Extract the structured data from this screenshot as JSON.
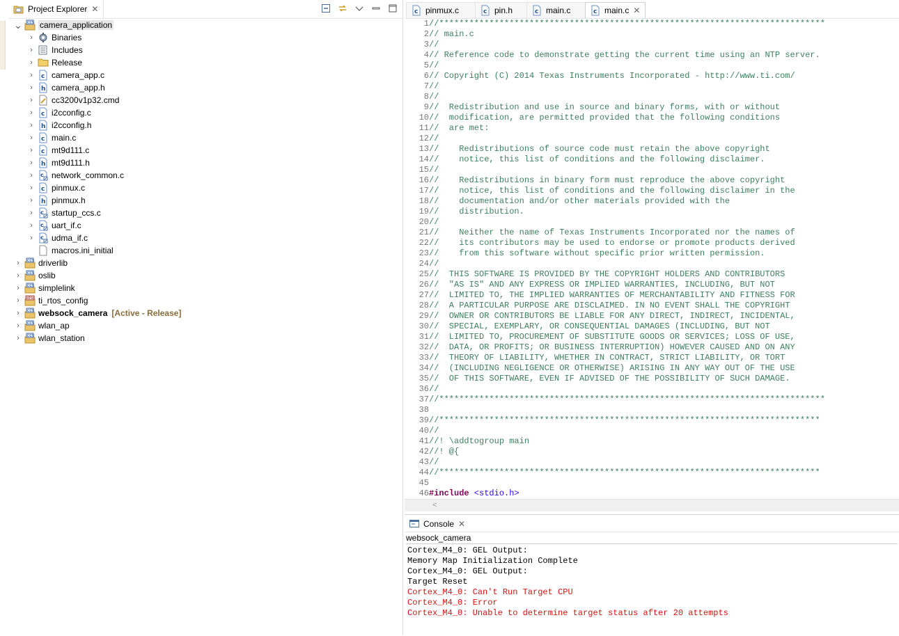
{
  "explorer": {
    "title": "Project Explorer",
    "items": [
      {
        "label": "camera_application",
        "depth": 0,
        "expanded": true,
        "icon": "ccs-project-icon",
        "selected": true
      },
      {
        "label": "Binaries",
        "depth": 1,
        "icon": "binaries-icon"
      },
      {
        "label": "Includes",
        "depth": 1,
        "icon": "includes-icon"
      },
      {
        "label": "Release",
        "depth": 1,
        "icon": "folder-icon"
      },
      {
        "label": "camera_app.c",
        "depth": 1,
        "icon": "c-file-icon"
      },
      {
        "label": "camera_app.h",
        "depth": 1,
        "icon": "h-file-icon"
      },
      {
        "label": "cc3200v1p32.cmd",
        "depth": 1,
        "icon": "cmd-file-icon"
      },
      {
        "label": "i2cconfig.c",
        "depth": 1,
        "icon": "c-file-icon"
      },
      {
        "label": "i2cconfig.h",
        "depth": 1,
        "icon": "h-file-icon"
      },
      {
        "label": "main.c",
        "depth": 1,
        "icon": "c-file-icon"
      },
      {
        "label": "mt9d111.c",
        "depth": 1,
        "icon": "c-file-icon"
      },
      {
        "label": "mt9d111.h",
        "depth": 1,
        "icon": "h-file-icon"
      },
      {
        "label": "network_common.c",
        "depth": 1,
        "icon": "linked-c-file-icon"
      },
      {
        "label": "pinmux.c",
        "depth": 1,
        "icon": "c-file-icon"
      },
      {
        "label": "pinmux.h",
        "depth": 1,
        "icon": "h-file-icon"
      },
      {
        "label": "startup_ccs.c",
        "depth": 1,
        "icon": "linked-c-file-icon"
      },
      {
        "label": "uart_if.c",
        "depth": 1,
        "icon": "linked-c-file-icon"
      },
      {
        "label": "udma_if.c",
        "depth": 1,
        "icon": "linked-c-file-icon"
      },
      {
        "label": "macros.ini_initial",
        "depth": 1,
        "icon": "file-icon",
        "no_chevron": true
      },
      {
        "label": "driverlib",
        "depth": 0,
        "icon": "ccs-project-icon"
      },
      {
        "label": "oslib",
        "depth": 0,
        "icon": "ccs-project-icon"
      },
      {
        "label": "simplelink",
        "depth": 0,
        "icon": "ccs-project-icon"
      },
      {
        "label": "ti_rtos_config",
        "depth": 0,
        "icon": "rtsc-project-icon"
      },
      {
        "label": "websock_camera",
        "depth": 0,
        "icon": "ccs-project-icon",
        "active": true,
        "badge": "[Active - Release]"
      },
      {
        "label": "wlan_ap",
        "depth": 0,
        "icon": "ccs-project-icon"
      },
      {
        "label": "wlan_station",
        "depth": 0,
        "icon": "ccs-project-icon"
      }
    ]
  },
  "editor": {
    "tabs": [
      {
        "label": "pinmux.c",
        "icon": "c-file-icon"
      },
      {
        "label": "pin.h",
        "icon": "c-file-icon"
      },
      {
        "label": "main.c",
        "icon": "c-file-icon"
      },
      {
        "label": "main.c",
        "icon": "c-file-icon",
        "active": true
      }
    ],
    "lines": [
      {
        "n": "1",
        "t": "//*****************************************************************************",
        "k": "ct"
      },
      {
        "n": "2",
        "t": "// main.c",
        "k": "ct"
      },
      {
        "n": "3",
        "t": "//",
        "k": "ct"
      },
      {
        "n": "4",
        "t": "// Reference code to demonstrate getting the current time using an NTP server.",
        "k": "ct"
      },
      {
        "n": "5",
        "t": "//",
        "k": "ct"
      },
      {
        "n": "6",
        "t": "// Copyright (C) 2014 Texas Instruments Incorporated - http://www.ti.com/",
        "k": "ct"
      },
      {
        "n": "7",
        "t": "//",
        "k": "ct"
      },
      {
        "n": "8",
        "t": "//",
        "k": "ct"
      },
      {
        "n": "9",
        "t": "//  Redistribution and use in source and binary forms, with or without",
        "k": "ct"
      },
      {
        "n": "10",
        "t": "//  modification, are permitted provided that the following conditions",
        "k": "ct"
      },
      {
        "n": "11",
        "t": "//  are met:",
        "k": "ct"
      },
      {
        "n": "12",
        "t": "//",
        "k": "ct"
      },
      {
        "n": "13",
        "t": "//    Redistributions of source code must retain the above copyright",
        "k": "ct"
      },
      {
        "n": "14",
        "t": "//    notice, this list of conditions and the following disclaimer.",
        "k": "ct"
      },
      {
        "n": "15",
        "t": "//",
        "k": "ct"
      },
      {
        "n": "16",
        "t": "//    Redistributions in binary form must reproduce the above copyright",
        "k": "ct"
      },
      {
        "n": "17",
        "t": "//    notice, this list of conditions and the following disclaimer in the",
        "k": "ct"
      },
      {
        "n": "18",
        "t": "//    documentation and/or other materials provided with the",
        "k": "ct"
      },
      {
        "n": "19",
        "t": "//    distribution.",
        "k": "ct"
      },
      {
        "n": "20",
        "t": "//",
        "k": "ct"
      },
      {
        "n": "21",
        "t": "//    Neither the name of Texas Instruments Incorporated nor the names of",
        "k": "ct"
      },
      {
        "n": "22",
        "t": "//    its contributors may be used to endorse or promote products derived",
        "k": "ct"
      },
      {
        "n": "23",
        "t": "//    from this software without specific prior written permission.",
        "k": "ct"
      },
      {
        "n": "24",
        "t": "//",
        "k": "ct"
      },
      {
        "n": "25",
        "t": "//  THIS SOFTWARE IS PROVIDED BY THE COPYRIGHT HOLDERS AND CONTRIBUTORS",
        "k": "ct"
      },
      {
        "n": "26",
        "t": "//  \"AS IS\" AND ANY EXPRESS OR IMPLIED WARRANTIES, INCLUDING, BUT NOT",
        "k": "ct"
      },
      {
        "n": "27",
        "t": "//  LIMITED TO, THE IMPLIED WARRANTIES OF MERCHANTABILITY AND FITNESS FOR",
        "k": "ct"
      },
      {
        "n": "28",
        "t": "//  A PARTICULAR PURPOSE ARE DISCLAIMED. IN NO EVENT SHALL THE COPYRIGHT",
        "k": "ct"
      },
      {
        "n": "29",
        "t": "//  OWNER OR CONTRIBUTORS BE LIABLE FOR ANY DIRECT, INDIRECT, INCIDENTAL,",
        "k": "ct"
      },
      {
        "n": "30",
        "t": "//  SPECIAL, EXEMPLARY, OR CONSEQUENTIAL DAMAGES (INCLUDING, BUT NOT",
        "k": "ct"
      },
      {
        "n": "31",
        "t": "//  LIMITED TO, PROCUREMENT OF SUBSTITUTE GOODS OR SERVICES; LOSS OF USE,",
        "k": "ct"
      },
      {
        "n": "32",
        "t": "//  DATA, OR PROFITS; OR BUSINESS INTERRUPTION) HOWEVER CAUSED AND ON ANY",
        "k": "ct"
      },
      {
        "n": "33",
        "t": "//  THEORY OF LIABILITY, WHETHER IN CONTRACT, STRICT LIABILITY, OR TORT",
        "k": "ct"
      },
      {
        "n": "34",
        "t": "//  (INCLUDING NEGLIGENCE OR OTHERWISE) ARISING IN ANY WAY OUT OF THE USE",
        "k": "ct"
      },
      {
        "n": "35",
        "t": "//  OF THIS SOFTWARE, EVEN IF ADVISED OF THE POSSIBILITY OF SUCH DAMAGE.",
        "k": "ct"
      },
      {
        "n": "36",
        "t": "//",
        "k": "ct"
      },
      {
        "n": "37",
        "t": "//*****************************************************************************",
        "k": "ct"
      },
      {
        "n": "38",
        "t": "",
        "k": "ct"
      },
      {
        "n": "39",
        "t": "//****************************************************************************",
        "k": "ct"
      },
      {
        "n": "40",
        "t": "//",
        "k": "ct"
      },
      {
        "n": "41",
        "t": "//! \\addtogroup main",
        "k": "ct"
      },
      {
        "n": "42",
        "t": "//! @{",
        "k": "ct"
      },
      {
        "n": "43",
        "t": "//",
        "k": "ct"
      },
      {
        "n": "44",
        "t": "//****************************************************************************",
        "k": "ct"
      },
      {
        "n": "45",
        "t": "",
        "k": "ct"
      },
      {
        "n": "46",
        "t": "#include",
        "k": "kw",
        "t2": " <stdio.h>"
      }
    ]
  },
  "console": {
    "title": "Console",
    "name": "websock_camera",
    "lines": [
      {
        "t": "Cortex_M4_0: GEL Output:",
        "err": false
      },
      {
        "t": "Memory Map Initialization Complete",
        "err": false
      },
      {
        "t": "Cortex_M4_0: GEL Output:",
        "err": false
      },
      {
        "t": "Target Reset",
        "err": false
      },
      {
        "t": "Cortex_M4_0: Can't Run Target CPU",
        "err": true
      },
      {
        "t": "Cortex_M4_0: Error",
        "err": true
      },
      {
        "t": "Cortex_M4_0: Unable to determine target status after 20 attempts",
        "err": true
      }
    ]
  },
  "colors": {
    "comment": "#3f7f5f",
    "keyword": "#7f0055",
    "include_string": "#2a00ff",
    "error_text": "#e01010",
    "active_badge": "#8a6d3b"
  }
}
